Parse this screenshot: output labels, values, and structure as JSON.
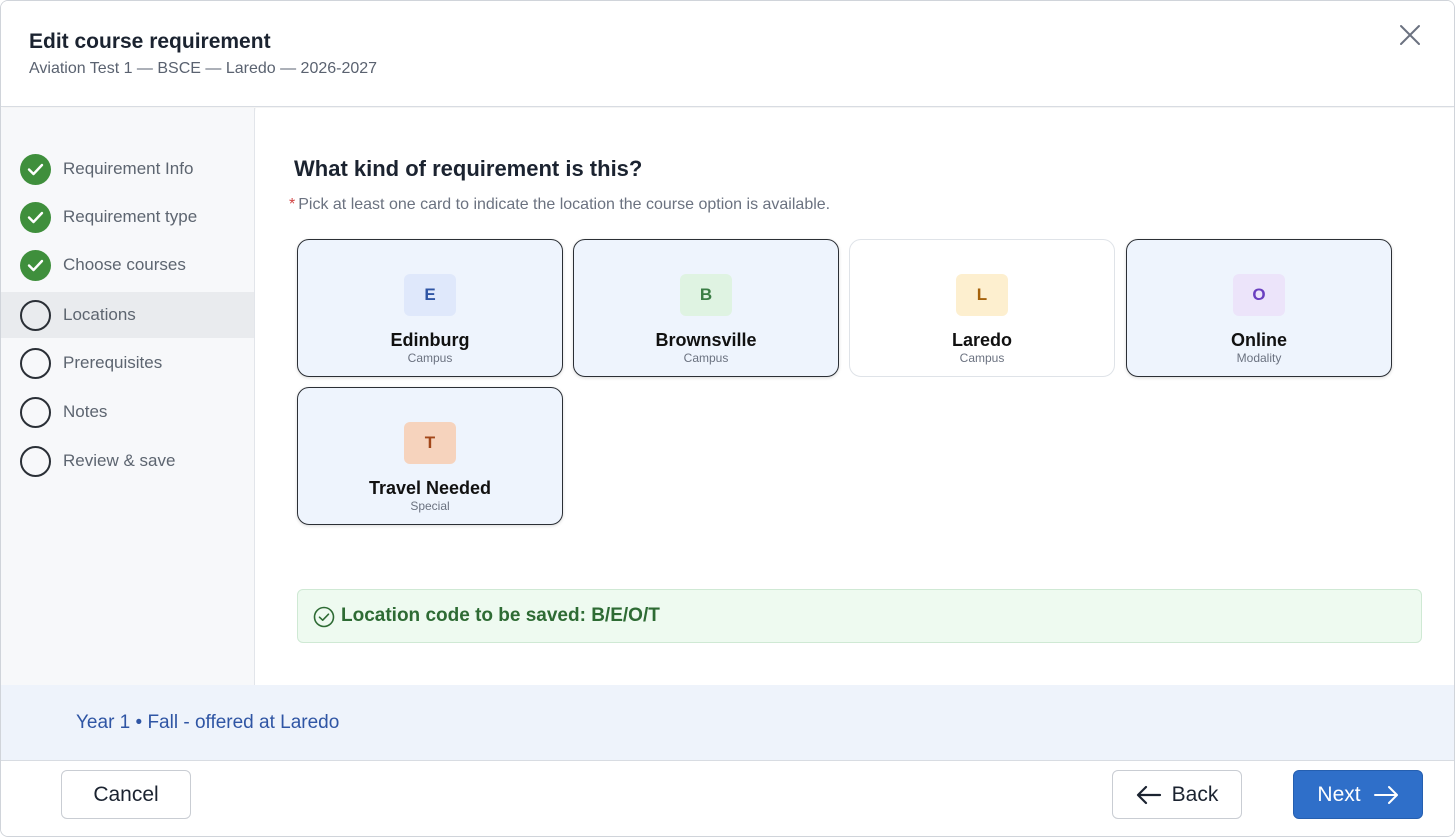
{
  "dialog": {
    "title": "Edit course requirement",
    "subtitle": "Aviation Test 1 — BSCE — Laredo — 2026-2027",
    "close_icon": "close-icon"
  },
  "steps": [
    {
      "label": "Requirement Info",
      "status": "done"
    },
    {
      "label": "Requirement type",
      "status": "done"
    },
    {
      "label": "Choose courses",
      "status": "done"
    },
    {
      "label": "Locations",
      "status": "current"
    },
    {
      "label": "Prerequisites",
      "status": "todo"
    },
    {
      "label": "Notes",
      "status": "todo"
    },
    {
      "label": "Review & save",
      "status": "todo"
    }
  ],
  "main": {
    "question": "What kind of requirement is this?",
    "hint_marker": "*",
    "hint": "Pick at least one card to indicate the location the course option is available.",
    "cards": [
      {
        "code": "E",
        "name": "Edinburg",
        "kind": "Campus",
        "selected": true,
        "badge_bg": "#dfe8fb",
        "badge_fg": "#2f55a4"
      },
      {
        "code": "B",
        "name": "Brownsville",
        "kind": "Campus",
        "selected": true,
        "badge_bg": "#dff3e2",
        "badge_fg": "#3a7d44"
      },
      {
        "code": "L",
        "name": "Laredo",
        "kind": "Campus",
        "selected": false,
        "badge_bg": "#fdefcf",
        "badge_fg": "#a5620c"
      },
      {
        "code": "O",
        "name": "Online",
        "kind": "Modality",
        "selected": true,
        "badge_bg": "#ece4fa",
        "badge_fg": "#6a3fc0"
      },
      {
        "code": "T",
        "name": "Travel Needed",
        "kind": "Special",
        "selected": true,
        "badge_bg": "#f6d3bd",
        "badge_fg": "#a2471a"
      }
    ],
    "result_text": "Location code to be saved: B/E/O/T"
  },
  "info_bar": {
    "text": "Year 1 • Fall - offered at Laredo"
  },
  "footer": {
    "cancel_label": "Cancel",
    "back_label": "Back",
    "next_label": "Next"
  },
  "colors": {
    "accent": "#2f6fc9",
    "done": "#3f8f3c",
    "success_text": "#2e6b34"
  }
}
